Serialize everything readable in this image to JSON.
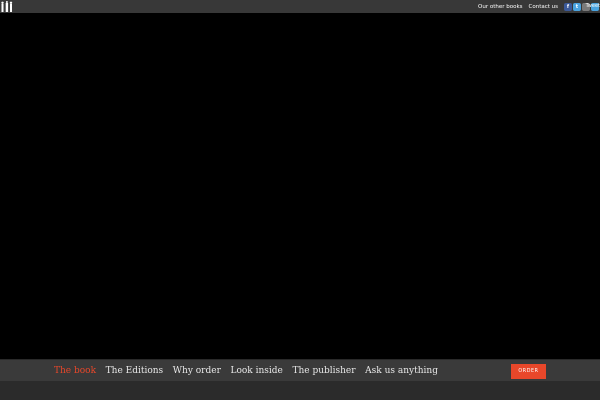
{
  "header": {
    "links": [
      {
        "label": "Our other books"
      },
      {
        "label": "Contact us"
      }
    ],
    "social": {
      "facebook_glyph": "f",
      "twitter_glyph": "t",
      "overlay_text": "Tweet"
    }
  },
  "nav": {
    "items": [
      {
        "label": "The book",
        "active": true
      },
      {
        "label": "The Editions",
        "active": false
      },
      {
        "label": "Why order",
        "active": false
      },
      {
        "label": "Look inside",
        "active": false
      },
      {
        "label": "The publisher",
        "active": false
      },
      {
        "label": "Ask us anything",
        "active": false
      }
    ],
    "order_label": "ORDER"
  },
  "colors": {
    "accent": "#e8472a",
    "topbar": "#383838",
    "navbar": "#3a3a3a",
    "background": "#000000"
  },
  "icons": {
    "logo": "three-figures-logo-icon",
    "facebook": "facebook-icon",
    "twitter": "twitter-icon"
  }
}
